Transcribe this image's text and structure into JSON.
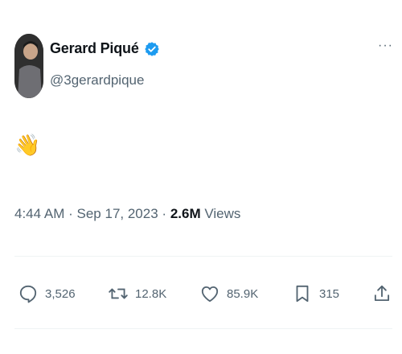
{
  "author": {
    "display_name": "Gerard Piqué",
    "handle": "@3gerardpique",
    "verified": true,
    "verified_badge_color": "#1d9bf0",
    "avatar_icon": "profile-photo"
  },
  "tweet": {
    "text": "👋",
    "time": "4:44 AM",
    "date": "Sep 17, 2023",
    "separator": "·",
    "views_count": "2.6M",
    "views_label": "Views"
  },
  "menu": {
    "icon": "more-icon",
    "label": "···"
  },
  "actions": {
    "reply_count": "3,526",
    "retweet_count": "12.8K",
    "like_count": "85.9K",
    "bookmark_count": "315"
  },
  "colors": {
    "text_primary": "#0f1419",
    "text_secondary": "#536471",
    "divider": "#eff3f4",
    "background": "#ffffff"
  }
}
